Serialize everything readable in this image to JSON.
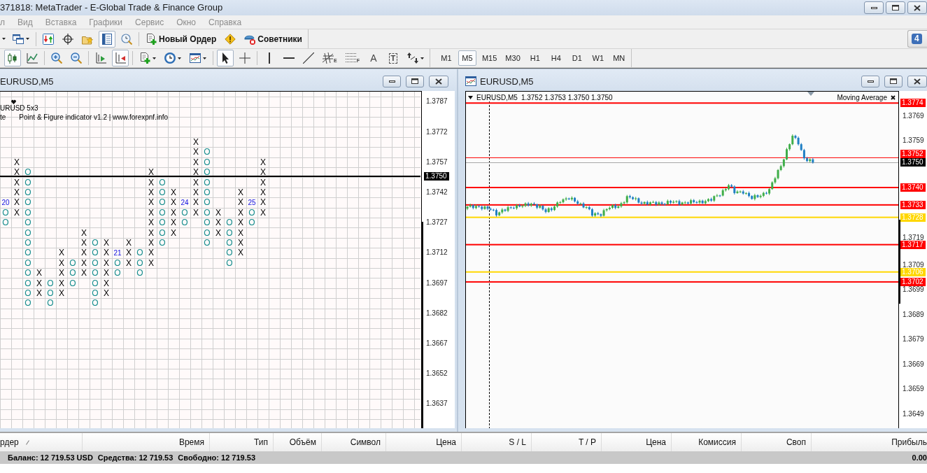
{
  "window": {
    "title": "371818: MetaTrader - E-Global Trade & Finance Group"
  },
  "menu": [
    {
      "label": "л",
      "disabled": true
    },
    {
      "label": "Вид",
      "disabled": true
    },
    {
      "label": "Вставка",
      "disabled": true
    },
    {
      "label": "Графики",
      "disabled": true
    },
    {
      "label": "Сервис",
      "disabled": true
    },
    {
      "label": "Окно",
      "disabled": true
    },
    {
      "label": "Справка",
      "disabled": true
    }
  ],
  "toolbar_top": {
    "groups": [
      [
        {
          "kind": "cut",
          "pressed": false
        },
        {
          "kind": "profiles",
          "pressed": false
        }
      ],
      [
        {
          "kind": "market",
          "pressed": false
        },
        {
          "kind": "datawindow",
          "pressed": false
        },
        {
          "kind": "navigator",
          "pressed": false
        },
        {
          "kind": "terminal",
          "pressed": true
        },
        {
          "kind": "tester",
          "pressed": false
        }
      ],
      [
        {
          "kind": "order",
          "label": "Новый Ордер",
          "pressed": false
        },
        {
          "kind": "alert",
          "pressed": false
        },
        {
          "kind": "experts",
          "label": "Советники",
          "pressed": false
        }
      ]
    ],
    "messages": "4"
  },
  "toolbar_chart": {
    "groups": [
      [
        {
          "kind": "candles",
          "pressed": true
        },
        {
          "kind": "line",
          "pressed": false
        }
      ],
      [
        {
          "kind": "zoomin",
          "pressed": false
        },
        {
          "kind": "zoomout",
          "pressed": false
        }
      ],
      [
        {
          "kind": "autoscroll",
          "pressed": false
        },
        {
          "kind": "shift",
          "pressed": true
        }
      ],
      [
        {
          "kind": "indicators",
          "pressed": false
        },
        {
          "kind": "periods",
          "pressed": false
        },
        {
          "kind": "templates",
          "pressed": false
        }
      ],
      [
        {
          "kind": "cursor",
          "pressed": true
        },
        {
          "kind": "cross",
          "pressed": false
        }
      ],
      [
        {
          "kind": "vline",
          "pressed": false
        },
        {
          "kind": "hline",
          "pressed": false
        },
        {
          "kind": "trend",
          "pressed": false
        },
        {
          "kind": "fibo",
          "letter": "E",
          "pressed": false
        },
        {
          "kind": "fibolines",
          "letter": "F",
          "pressed": false
        },
        {
          "kind": "text",
          "letter": "A",
          "pressed": false
        },
        {
          "kind": "label",
          "letter": "T",
          "pressed": false
        },
        {
          "kind": "arrows",
          "pressed": false
        }
      ]
    ],
    "timeframes": [
      {
        "label": "M1",
        "selected": false
      },
      {
        "label": "M5",
        "selected": true
      },
      {
        "label": "M15",
        "selected": false
      },
      {
        "label": "M30",
        "selected": false
      },
      {
        "label": "H1",
        "selected": false
      },
      {
        "label": "H4",
        "selected": false
      },
      {
        "label": "D1",
        "selected": false
      },
      {
        "label": "W1",
        "selected": false
      },
      {
        "label": "MN",
        "selected": false
      }
    ]
  },
  "left_chart": {
    "title": "EURUSD,M5",
    "header": {
      "symbol": "URUSD 5x3",
      "column_1": "te",
      "indicator": "Point & Figure indicator v1.2 | www.forexpnf.info"
    },
    "columns": [
      {
        "kind": "o",
        "label": "20",
        "marks": [
          "O",
          "O"
        ]
      },
      {
        "kind": "x",
        "marks": [
          "X",
          "X",
          "X",
          "X",
          "X",
          "X"
        ]
      },
      {
        "kind": "o",
        "marks": [
          "O",
          "O",
          "O",
          "O",
          "O",
          "O",
          "O",
          "O",
          "O",
          "O",
          "O",
          "O",
          "O",
          "O"
        ]
      },
      {
        "kind": "x",
        "marks": [
          "X",
          "X",
          "X"
        ]
      },
      {
        "kind": "o",
        "marks": [
          "O",
          "O",
          "O"
        ]
      },
      {
        "kind": "x",
        "marks": [
          "X",
          "X",
          "X",
          "X",
          "X"
        ]
      },
      {
        "kind": "o",
        "marks": [
          "O",
          "O",
          "O"
        ]
      },
      {
        "kind": "x",
        "marks": [
          "X",
          "X",
          "X",
          "X",
          "X"
        ]
      },
      {
        "kind": "o",
        "marks": [
          "O",
          "O",
          "O",
          "O",
          "O",
          "O",
          "O"
        ]
      },
      {
        "kind": "x",
        "marks": [
          "X",
          "X",
          "X",
          "X",
          "X",
          "X"
        ]
      },
      {
        "kind": "o",
        "label": "21",
        "marks": [
          "O",
          "O"
        ]
      },
      {
        "kind": "x",
        "marks": [
          "X",
          "X",
          "X"
        ]
      },
      {
        "kind": "o",
        "marks": [
          "O",
          "O",
          "O"
        ]
      },
      {
        "kind": "x",
        "marks": [
          "X",
          "X",
          "X",
          "X",
          "X",
          "X",
          "X",
          "X",
          "X",
          "X"
        ]
      },
      {
        "kind": "o",
        "marks": [
          "O",
          "O",
          "O",
          "O",
          "O",
          "O",
          "O"
        ]
      },
      {
        "kind": "x",
        "marks": [
          "X",
          "X",
          "X",
          "X",
          "X"
        ]
      },
      {
        "kind": "o",
        "label": "24",
        "marks": [
          "O",
          "O"
        ]
      },
      {
        "kind": "x",
        "marks": [
          "X",
          "X",
          "X",
          "X",
          "X",
          "X",
          "X",
          "X"
        ]
      },
      {
        "kind": "o",
        "marks": [
          "O",
          "O",
          "O",
          "O",
          "O",
          "O",
          "O",
          "O",
          "O",
          "O"
        ]
      },
      {
        "kind": "x",
        "marks": [
          "X",
          "X",
          "X"
        ]
      },
      {
        "kind": "o",
        "marks": [
          "O",
          "O",
          "O",
          "O",
          "O"
        ]
      },
      {
        "kind": "x",
        "marks": [
          "X",
          "X",
          "X",
          "X",
          "X",
          "X",
          "X"
        ]
      },
      {
        "kind": "o",
        "label": "25",
        "marks": [
          "O",
          "O"
        ]
      },
      {
        "kind": "x",
        "marks": [
          "X",
          "X",
          "X",
          "X",
          "X",
          "X"
        ]
      }
    ],
    "axis": [
      "1.3787",
      "1.3772",
      "1.3757",
      "1.3742",
      "1.3727",
      "1.3712",
      "1.3697",
      "1.3682",
      "1.3667",
      "1.3652",
      "1.3637"
    ],
    "current_price": "1.3750"
  },
  "right_chart": {
    "title": "EURUSD,M5",
    "legend": {
      "symbol": "EURUSD,M5",
      "values": "1.3752 1.3753 1.3750 1.3750"
    },
    "indicator": "Moving Average",
    "axis": [
      "1.3769",
      "1.3759",
      "1.3719",
      "1.3709",
      "1.3699",
      "1.3689",
      "1.3679",
      "1.3669",
      "1.3659",
      "1.3649"
    ],
    "levels": [
      {
        "kind": "level",
        "label": "1.3774",
        "color": "#ff0000"
      },
      {
        "kind": "ask",
        "label": "1.3752",
        "color": "#ff0000"
      },
      {
        "kind": "bid",
        "label": "1.3750",
        "color": "#000000"
      },
      {
        "kind": "level",
        "label": "1.3740",
        "color": "#ff0000"
      },
      {
        "kind": "level",
        "label": "1.3733",
        "color": "#ff0000"
      },
      {
        "kind": "level",
        "label": "1.3728",
        "color": "#ffd700"
      },
      {
        "kind": "level",
        "label": "1.3717",
        "color": "#ff0000"
      },
      {
        "kind": "level",
        "label": "1.3706",
        "color": "#ffd700"
      },
      {
        "kind": "level",
        "label": "1.3702",
        "color": "#ff0000"
      }
    ]
  },
  "terminal": {
    "columns": [
      {
        "label": "рдер",
        "sorted": true
      },
      {
        "label": "Время",
        "sorted": false
      },
      {
        "label": "Тип",
        "sorted": false
      },
      {
        "label": "Объём",
        "sorted": false
      },
      {
        "label": "Символ",
        "sorted": false
      },
      {
        "label": "Цена",
        "sorted": false
      },
      {
        "label": "S / L",
        "sorted": false
      },
      {
        "label": "T / P",
        "sorted": false
      },
      {
        "label": "Цена",
        "sorted": false
      },
      {
        "label": "Комиссия",
        "sorted": false
      },
      {
        "label": "Своп",
        "sorted": false
      },
      {
        "label": "Прибыль",
        "sorted": false
      }
    ]
  },
  "status_bar": {
    "balance": "Баланс: 12 719.53 USD",
    "equity": "Средства: 12 719.53",
    "free_margin": "Свободно: 12 719.53",
    "profit": "0.00"
  }
}
